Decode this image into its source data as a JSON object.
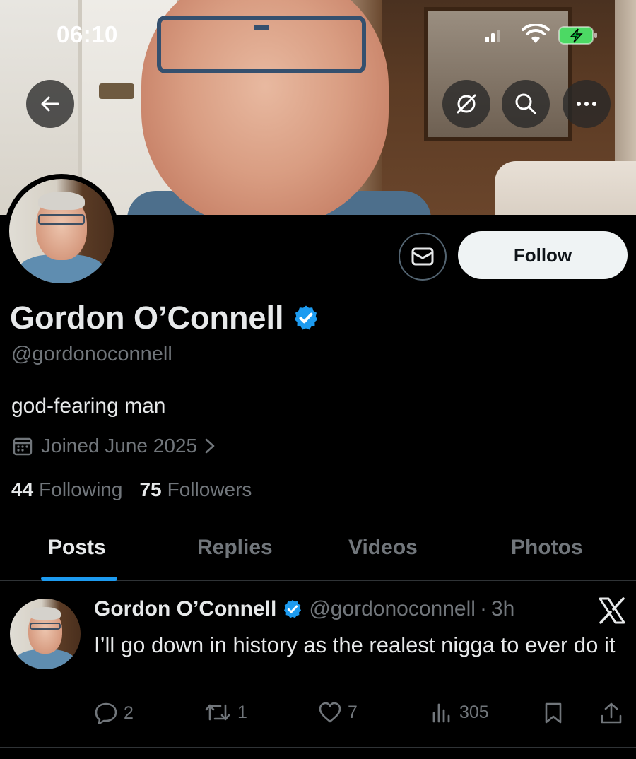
{
  "status_bar": {
    "time": "06:10"
  },
  "profile": {
    "name": "Gordon O’Connell",
    "handle": "@gordonoconnell",
    "bio": "god-fearing man",
    "joined": "Joined June 2025",
    "following_count": "44",
    "following_label": "Following",
    "followers_count": "75",
    "followers_label": "Followers",
    "follow_button": "Follow"
  },
  "tabs": [
    {
      "label": "Posts",
      "active": true
    },
    {
      "label": "Replies",
      "active": false
    },
    {
      "label": "Videos",
      "active": false
    },
    {
      "label": "Photos",
      "active": false
    }
  ],
  "post": {
    "name": "Gordon O’Connell",
    "handle": "@gordonoconnell",
    "separator": "·",
    "time": "3h",
    "text": "I’ll go down in history as the realest nigga to ever do it",
    "replies": "2",
    "reposts": "1",
    "likes": "7",
    "views": "305"
  },
  "icons": {
    "back": "arrow-left-icon",
    "grok": "grok-icon",
    "search": "search-icon",
    "more": "more-icon",
    "message": "envelope-icon",
    "verified": "verified-badge-icon",
    "calendar": "calendar-icon",
    "x_logo": "x-logo-icon"
  },
  "colors": {
    "accent": "#1d9bf0",
    "background": "#000000",
    "text_primary": "#e7e9ea",
    "text_secondary": "#71767b",
    "battery": "#4cd964"
  }
}
